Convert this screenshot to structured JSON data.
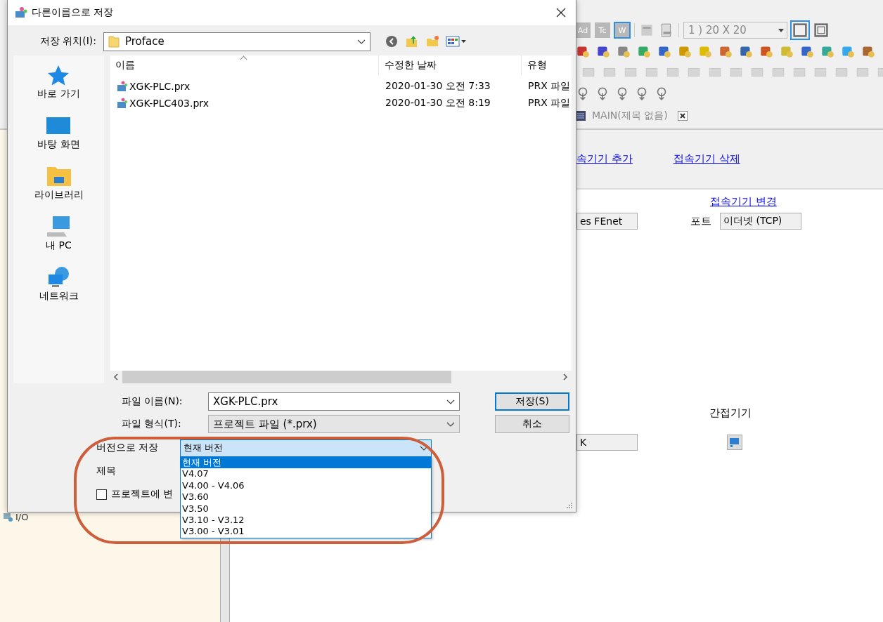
{
  "app": {
    "toolbar_text_buttons": [
      {
        "label": "Ad",
        "selected": false
      },
      {
        "label": "Tc",
        "selected": false
      },
      {
        "label": "W",
        "selected": true
      }
    ],
    "grid_combo": "1 ) 20 X 20",
    "tab": {
      "label": "MAIN(제목 없음)"
    },
    "links": [
      "속기기 추가",
      "접속기기 삭제"
    ],
    "change_link": "접속기기 변경",
    "device_field": "es FEnet",
    "port_label": "포트",
    "port_value": "이더넷 (TCP)",
    "indirect_label": "간접기기",
    "indirect_field": "K",
    "tree_item": "I/O"
  },
  "dialog": {
    "title": "다른이름으로 저장",
    "location": {
      "label": "저장 위치(I):",
      "value": "Proface"
    },
    "places": [
      {
        "label": "바로 가기",
        "kind": "star"
      },
      {
        "label": "바탕 화면",
        "kind": "desktop"
      },
      {
        "label": "라이브러리",
        "kind": "library"
      },
      {
        "label": "내 PC",
        "kind": "pc"
      },
      {
        "label": "네트워크",
        "kind": "network"
      }
    ],
    "columns": [
      "이름",
      "수정한 날짜",
      "유형"
    ],
    "files": [
      {
        "name": "XGK-PLC.prx",
        "modified": "2020-01-30 오전 7:33",
        "type": "PRX 파일"
      },
      {
        "name": "XGK-PLC403.prx",
        "modified": "2020-01-30 오전 8:19",
        "type": "PRX 파일"
      }
    ],
    "file_name": {
      "label": "파일 이름(N):",
      "value": "XGK-PLC.prx"
    },
    "file_type": {
      "label": "파일 형식(T):",
      "value": "프로젝트 파일 (*.prx)"
    },
    "buttons": [
      "저장(S)",
      "취소"
    ],
    "save_version": {
      "label": "버전으로 저장",
      "value": "현재 버전",
      "options": [
        {
          "label": "현재 버전",
          "selected": true
        },
        {
          "label": "V4.07",
          "selected": false
        },
        {
          "label": "V4.00 - V4.06",
          "selected": false
        },
        {
          "label": "V3.60",
          "selected": false
        },
        {
          "label": "V3.50",
          "selected": false
        },
        {
          "label": "V3.10 - V3.12",
          "selected": false
        },
        {
          "label": "V3.00 - V3.01",
          "selected": false
        }
      ]
    },
    "title_label": "제목",
    "option": {
      "label": "프로젝트에 변",
      "checked": false
    }
  }
}
